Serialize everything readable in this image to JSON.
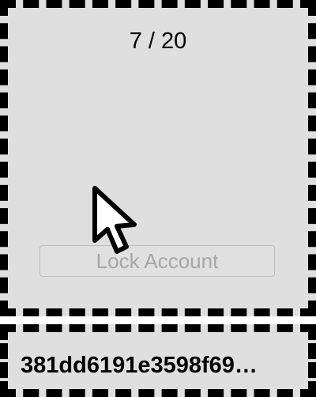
{
  "pager": {
    "counter": "7 / 20"
  },
  "actions": {
    "lock_label": "Lock Account"
  },
  "footer": {
    "hash": "381dd6191e3598f69…"
  },
  "colors": {
    "panel_bg": "#dfdfdf",
    "border": "#000000",
    "button_text_disabled": "#a6a6a6"
  },
  "icons": {
    "cursor": "arrow-cursor-icon"
  }
}
